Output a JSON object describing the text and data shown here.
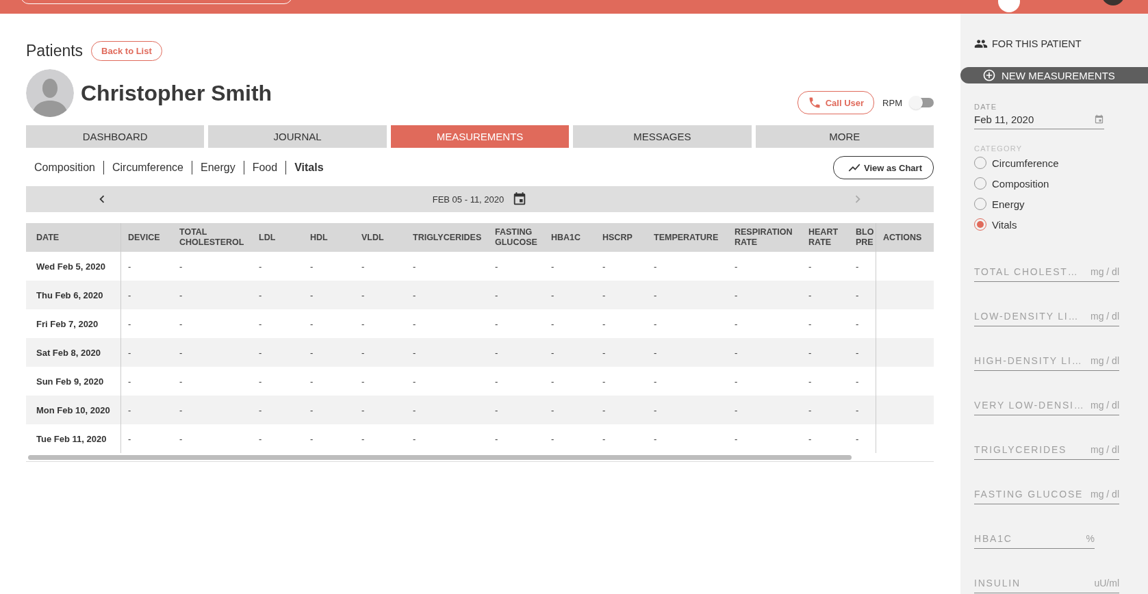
{
  "header": {
    "title": "Patients",
    "back_button": "Back to List",
    "patient_name": "Christopher Smith",
    "call_button": "Call User",
    "rpm": {
      "label": "RPM",
      "on": false
    }
  },
  "tabs": [
    {
      "label": "DASHBOARD",
      "selected": false
    },
    {
      "label": "JOURNAL",
      "selected": false
    },
    {
      "label": "MEASUREMENTS",
      "selected": true
    },
    {
      "label": "MESSAGES",
      "selected": false
    },
    {
      "label": "MORE",
      "selected": false
    }
  ],
  "subtabs": [
    {
      "label": "Composition",
      "selected": false
    },
    {
      "label": "Circumference",
      "selected": false
    },
    {
      "label": "Energy",
      "selected": false
    },
    {
      "label": "Food",
      "selected": false
    },
    {
      "label": "Vitals",
      "selected": true
    }
  ],
  "view_chart_button": "View as Chart",
  "date_nav": {
    "range": "FEB 05 - 11, 2020",
    "prev_disabled": false,
    "next_disabled": true
  },
  "table": {
    "columns": [
      "DATE",
      "DEVICE",
      "TOTAL CHOLESTEROL",
      "LDL",
      "HDL",
      "VLDL",
      "TRIGLYCERIDES",
      "FASTING GLUCOSE",
      "HBA1C",
      "HSCRP",
      "TEMPERATURE",
      "RESPIRATION RATE",
      "HEART RATE",
      "BLO PRE",
      "ACTIONS"
    ],
    "rows": [
      {
        "date": "Wed Feb 5, 2020",
        "values": [
          "-",
          "-",
          "-",
          "-",
          "-",
          "-",
          "-",
          "-",
          "-",
          "-",
          "-",
          "-",
          "-"
        ]
      },
      {
        "date": "Thu Feb 6, 2020",
        "values": [
          "-",
          "-",
          "-",
          "-",
          "-",
          "-",
          "-",
          "-",
          "-",
          "-",
          "-",
          "-",
          "-"
        ]
      },
      {
        "date": "Fri Feb 7, 2020",
        "values": [
          "-",
          "-",
          "-",
          "-",
          "-",
          "-",
          "-",
          "-",
          "-",
          "-",
          "-",
          "-",
          "-"
        ]
      },
      {
        "date": "Sat Feb 8, 2020",
        "values": [
          "-",
          "-",
          "-",
          "-",
          "-",
          "-",
          "-",
          "-",
          "-",
          "-",
          "-",
          "-",
          "-"
        ]
      },
      {
        "date": "Sun Feb 9, 2020",
        "values": [
          "-",
          "-",
          "-",
          "-",
          "-",
          "-",
          "-",
          "-",
          "-",
          "-",
          "-",
          "-",
          "-"
        ]
      },
      {
        "date": "Mon Feb 10, 2020",
        "values": [
          "-",
          "-",
          "-",
          "-",
          "-",
          "-",
          "-",
          "-",
          "-",
          "-",
          "-",
          "-",
          "-"
        ]
      },
      {
        "date": "Tue Feb 11, 2020",
        "values": [
          "-",
          "-",
          "-",
          "-",
          "-",
          "-",
          "-",
          "-",
          "-",
          "-",
          "-",
          "-",
          "-"
        ]
      }
    ]
  },
  "sidebar": {
    "title": "FOR THIS PATIENT",
    "new_button": "NEW MEASUREMENTS",
    "date_label": "DATE",
    "date_value": "Feb 11, 2020",
    "category_label": "CATEGORY",
    "categories": [
      {
        "label": "Circumference",
        "selected": false
      },
      {
        "label": "Composition",
        "selected": false
      },
      {
        "label": "Energy",
        "selected": false
      },
      {
        "label": "Vitals",
        "selected": true
      }
    ],
    "fields": [
      {
        "placeholder": "TOTAL CHOLEST…",
        "unit": "mg / dl"
      },
      {
        "placeholder": "LOW-DENSITY LI…",
        "unit": "mg / dl"
      },
      {
        "placeholder": "HIGH-DENSITY LI…",
        "unit": "mg / dl"
      },
      {
        "placeholder": "VERY LOW-DENSI…",
        "unit": "mg / dl"
      },
      {
        "placeholder": "TRIGLYCERIDES",
        "unit": "mg / dl"
      },
      {
        "placeholder": "FASTING GLUCOSE",
        "unit": "mg / dl"
      },
      {
        "placeholder": "HBA1C",
        "unit": "%"
      },
      {
        "placeholder": "INSULIN",
        "unit": "uU/ml"
      }
    ]
  }
}
